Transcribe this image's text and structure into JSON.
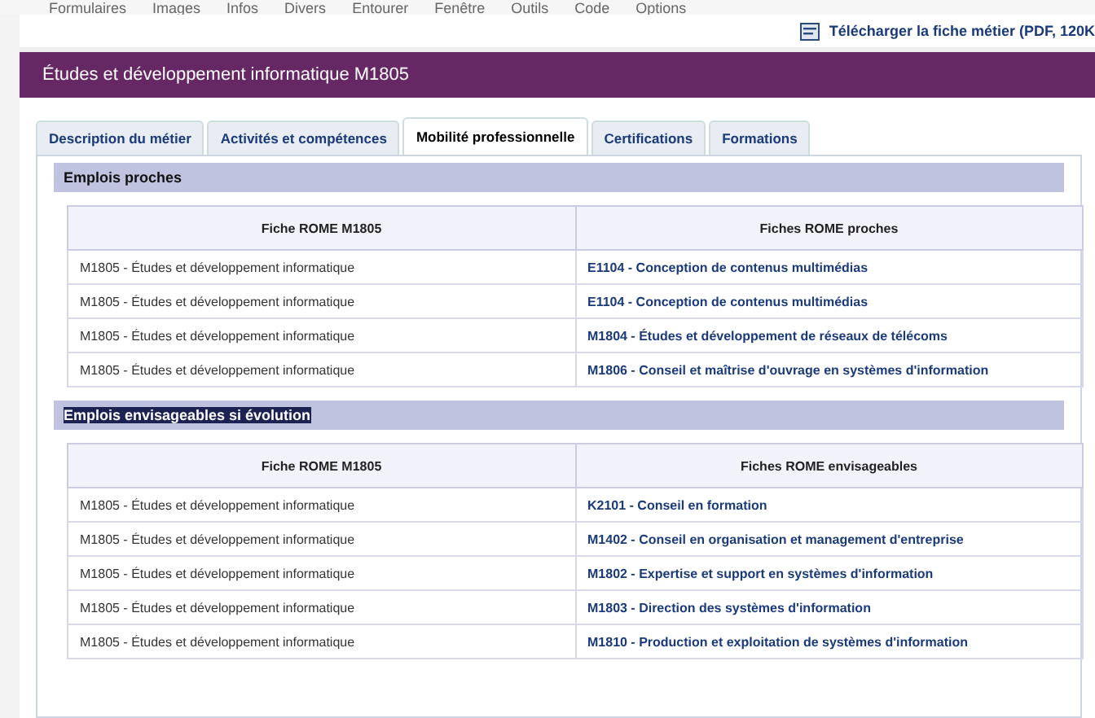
{
  "toolbar": {
    "items": [
      "Formulaires",
      "Images",
      "Infos",
      "Divers",
      "Entourer",
      "Fenêtre",
      "Outils",
      "Code",
      "Options"
    ]
  },
  "download_link": "Télécharger la fiche métier (PDF, 120K",
  "title": "Études et développement informatique M1805",
  "tabs": [
    {
      "label": "Description du métier",
      "selected": false
    },
    {
      "label": "Activités et compétences",
      "selected": false
    },
    {
      "label": "Mobilité professionnelle",
      "selected": true
    },
    {
      "label": "Certifications",
      "selected": false
    },
    {
      "label": "Formations",
      "selected": false
    }
  ],
  "sections": [
    {
      "heading": "Emplois proches",
      "selected": false,
      "columns": [
        "Fiche ROME M1805",
        "Fiches ROME proches"
      ],
      "rows": [
        [
          "M1805 - Études et développement informatique",
          "E1104 - Conception de contenus multimédias"
        ],
        [
          "M1805 - Études et développement informatique",
          "E1104 - Conception de contenus multimédias"
        ],
        [
          "M1805 - Études et développement informatique",
          "M1804 - Études et développement de réseaux de télécoms"
        ],
        [
          "M1805 - Études et développement informatique",
          "M1806 - Conseil et maîtrise d'ouvrage en systèmes d'information"
        ]
      ]
    },
    {
      "heading": "Emplois envisageables si évolution",
      "selected": true,
      "columns": [
        "Fiche ROME M1805",
        "Fiches ROME envisageables"
      ],
      "rows": [
        [
          "M1805 - Études et développement informatique",
          "K2101 - Conseil en formation"
        ],
        [
          "M1805 - Études et développement informatique",
          "M1402 - Conseil en organisation et management d'entreprise"
        ],
        [
          "M1805 - Études et développement informatique",
          "M1802 - Expertise et support en systèmes d'information"
        ],
        [
          "M1805 - Études et développement informatique",
          "M1803 - Direction des systèmes d'information"
        ],
        [
          "M1805 - Études et développement informatique",
          "M1810 - Production et exploitation de systèmes d'information"
        ]
      ]
    }
  ]
}
